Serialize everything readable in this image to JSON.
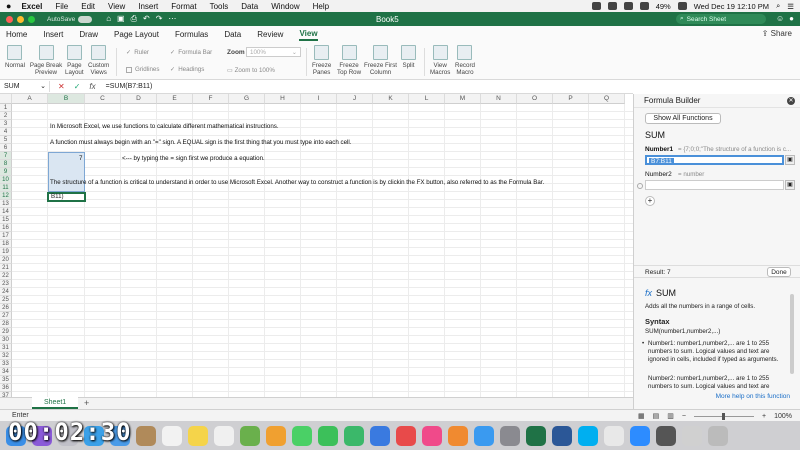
{
  "menubar": {
    "app": "Excel",
    "items": [
      "File",
      "Edit",
      "View",
      "Insert",
      "Format",
      "Tools",
      "Data",
      "Window",
      "Help"
    ],
    "battery": "49%",
    "clock": "Wed Dec 19  12:10 PM"
  },
  "titlebar": {
    "autosave_label": "AutoSave",
    "autosave_state": "OFF",
    "title": "Book5",
    "search_placeholder": "Search Sheet"
  },
  "ribbon_tabs": [
    "Home",
    "Insert",
    "Draw",
    "Page Layout",
    "Formulas",
    "Data",
    "Review",
    "View"
  ],
  "active_tab": "View",
  "share_label": "Share",
  "ribbon": {
    "normal": "Normal",
    "page_break": "Page Break\nPreview",
    "page_layout": "Page\nLayout",
    "custom_views": "Custom\nViews",
    "ruler": "Ruler",
    "formula_bar": "Formula Bar",
    "gridlines": "Gridlines",
    "headings": "Headings",
    "zoom_label": "Zoom",
    "zoom_value": "100%",
    "zoom_to_100": "Zoom to 100%",
    "freeze_panes": "Freeze\nPanes",
    "freeze_top_row": "Freeze\nTop Row",
    "freeze_first_column": "Freeze First\nColumn",
    "split": "Split",
    "view_macros": "View\nMacros",
    "record_macro": "Record\nMacro"
  },
  "formula_bar": {
    "name_box": "SUM",
    "cancel_icon": "✕",
    "enter_icon": "✓",
    "fx_label": "fx",
    "formula": "=SUM(B7:B11)"
  },
  "columns": [
    "A",
    "B",
    "C",
    "D",
    "E",
    "F",
    "G",
    "H",
    "I",
    "J",
    "K",
    "L",
    "M",
    "N",
    "O",
    "P",
    "Q"
  ],
  "rows": [
    "1",
    "2",
    "3",
    "4",
    "5",
    "6",
    "7",
    "8",
    "9",
    "10",
    "11",
    "12",
    "13",
    "14",
    "15",
    "16",
    "17",
    "18",
    "19",
    "20",
    "21",
    "22",
    "23",
    "24",
    "25",
    "26",
    "27",
    "28",
    "29",
    "30",
    "31",
    "32",
    "33",
    "34",
    "35",
    "36",
    "37"
  ],
  "cells": {
    "b3": "In Microsoft Excel, we use functions to calculate different mathematical instructions.",
    "b5": "A function must always begin with an \"=\" sign. A EQUAL sign is the first thing that you must type into each cell.",
    "b7_value": "7",
    "c7": "<--- by typing the = sign first we produce a equation.",
    "b10": "The structure of a function is critical to understand in order to use Microsoft Excel. Another way to construct a function is by clickin the FX button, also referred to as the Formula Bar.",
    "b12": "B11)"
  },
  "sheet_tab": "Sheet1",
  "status": {
    "mode": "Enter",
    "zoom": "100%"
  },
  "formula_builder": {
    "title": "Formula Builder",
    "show_all": "Show All Functions",
    "function_name": "SUM",
    "number1_label": "Number1",
    "number1_preview": "= {7;0;0;\"The structure of a function is c...",
    "number1_value": "B7:B11",
    "number2_label": "Number2",
    "number2_preview": "=  number",
    "result_label": "Result: 7",
    "done_label": "Done",
    "help_title": "SUM",
    "help_fx": "fx",
    "help_desc": "Adds all the numbers in a range of cells.",
    "syntax_heading": "Syntax",
    "syntax": "SUM(number1,number2,...)",
    "item1": "Number1: number1,number2,... are 1 to 255 numbers to sum. Logical values and text are ignored in cells, included if typed as arguments.",
    "item2": "Number2: number1,number2,... are 1 to 255 numbers to sum. Logical values and text are",
    "more_help": "More help on this function"
  },
  "overlay_timer": "00:02:30",
  "dock_icons": [
    "finder-icon",
    "siri-icon",
    "launchpad-icon",
    "safari-icon",
    "mail-icon",
    "contacts-icon",
    "calendar-icon",
    "notes-icon",
    "reminders-icon",
    "maps-icon",
    "photos-icon",
    "messages-icon",
    "facetime-icon",
    "numbers-icon",
    "keynote-icon",
    "news-icon",
    "itunes-icon",
    "ibooks-icon",
    "appstore-icon",
    "preferences-icon",
    "excel-icon",
    "word-icon",
    "skype-icon",
    "chrome-icon",
    "zoom-icon",
    "quicktime-icon",
    "preview-icon",
    "trash-icon"
  ],
  "colors": {
    "excel_green": "#1f7246",
    "selection_blue": "#dae6f2",
    "link_blue": "#1a6ec7"
  }
}
